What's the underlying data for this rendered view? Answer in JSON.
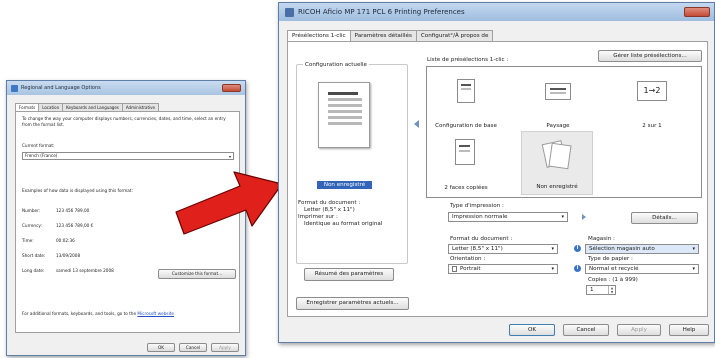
{
  "left_window": {
    "title": "Regional and Language Options",
    "tabs": [
      "Formats",
      "Location",
      "Keyboards and Languages",
      "Administrative"
    ],
    "description": "To change the way your computer displays numbers, currencies, dates, and time, select an entry from the format list.",
    "current_format_label": "Current format:",
    "current_format_value": "French (France)",
    "examples_label": "Examples of how data is displayed using this format:",
    "examples": [
      {
        "label": "Number:",
        "value": "123 456 789,00"
      },
      {
        "label": "Currency:",
        "value": "123 456 789,00 €"
      },
      {
        "label": "Time:",
        "value": "00:02:36"
      },
      {
        "label": "Short date:",
        "value": "13/09/2008"
      },
      {
        "label": "Long date:",
        "value": "samedi 13 septembre 2008"
      }
    ],
    "customize_button": "Customize this format...",
    "footer_text": "For additional formats, keyboards, and tools, go to the",
    "footer_link": "Microsoft website",
    "ok_button": "OK",
    "cancel_button": "Cancel",
    "apply_button": "Apply"
  },
  "right_window": {
    "title": "RICOH Aficio MP 171 PCL 6 Printing Preferences",
    "tabs": [
      "Présélections 1-clic",
      "Paramètres détaillés",
      "Configurat°/À propos de"
    ],
    "manage_presets_button": "Gérer liste présélections...",
    "current_config_label": "Configuration actuelle",
    "presets_list_label": "Liste de présélections 1-clic :",
    "presets": [
      {
        "label": "Configuration de base",
        "icon": "document-icon"
      },
      {
        "label": "Paysage",
        "icon": "landscape-icon"
      },
      {
        "label": "2 sur 1",
        "icon": "two-up-icon",
        "glyph": "1→2"
      },
      {
        "label": "2 faces copiées",
        "icon": "duplex-icon"
      },
      {
        "label": "Non enregistré",
        "icon": "unsaved-preset-icon"
      }
    ],
    "not_saved_label": "Non enregistré",
    "summary_lines": [
      "Format du document :",
      "Letter (8,5\" x 11\")",
      "Imprimer sur :",
      "Identique au format original"
    ],
    "summary_button": "Résumé des paramètres",
    "save_current_button": "Enregistrer paramètres actuels...",
    "print_type_label": "Type d'impression :",
    "print_type_value": "Impression normale",
    "details_button": "Détails...",
    "doc_format_label": "Format du document :",
    "doc_format_value": "Letter (8,5\" x 11\")",
    "orientation_label": "Orientation :",
    "orientation_value": "Portrait",
    "tray_label": "Magasin :",
    "tray_value": "Sélection magasin auto",
    "paper_type_label": "Type de papier :",
    "paper_type_value": "Normal et recyclé",
    "copies_label": "Copies : (1 à 999)",
    "copies_value": "1",
    "ok_button": "OK",
    "cancel_button": "Cancel",
    "apply_button": "Apply",
    "help_button": "Help"
  },
  "colors": {
    "arrow": "#e0201a",
    "selection": "#3264b8",
    "window_border": "#5e7ea8"
  }
}
